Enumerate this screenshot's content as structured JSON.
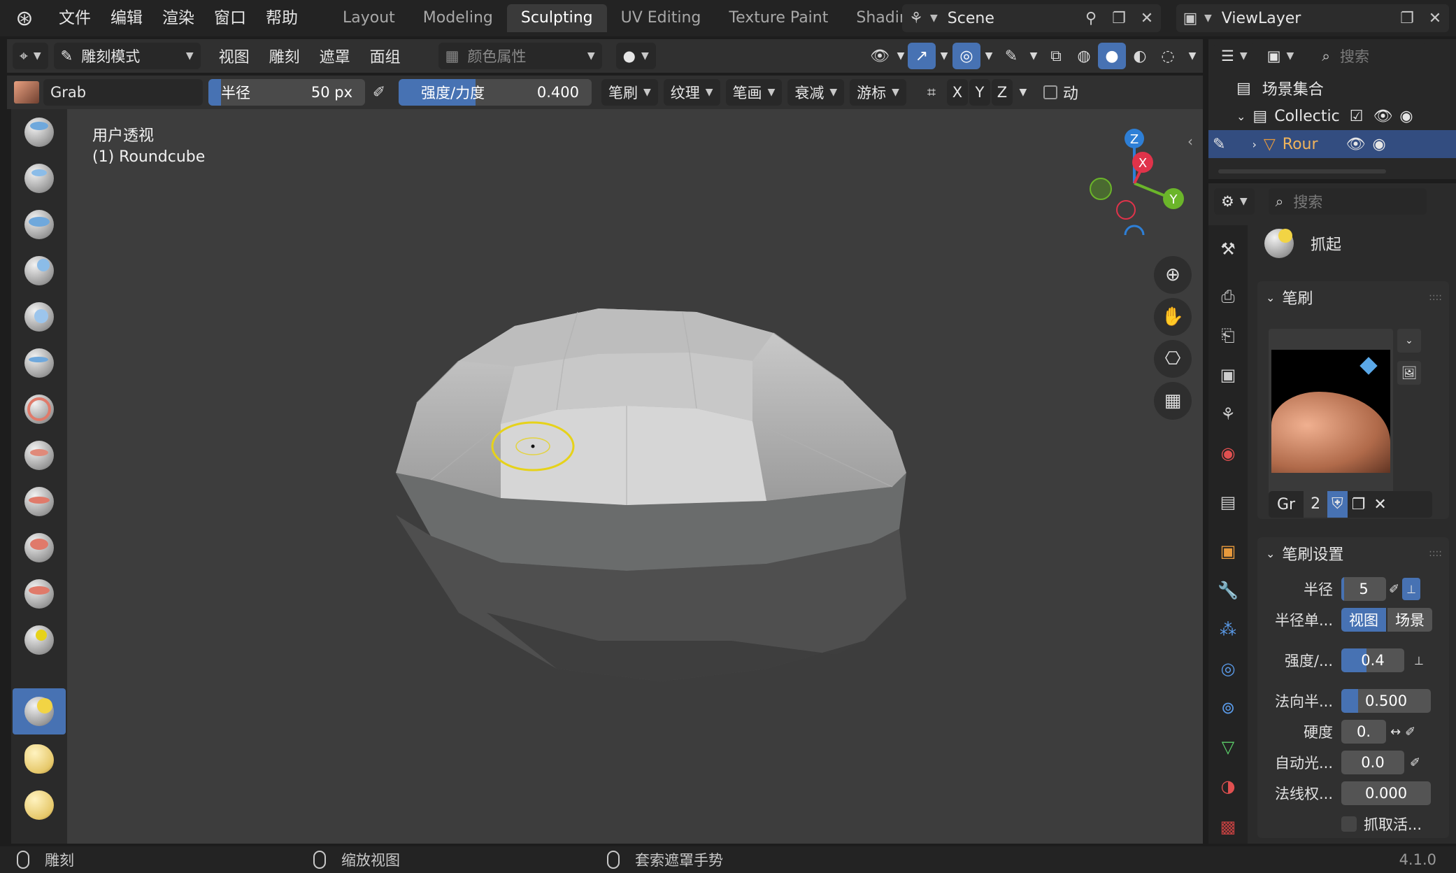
{
  "menu": {
    "items": [
      "文件",
      "编辑",
      "渲染",
      "窗口",
      "帮助"
    ]
  },
  "workspaces": {
    "tabs": [
      "Layout",
      "Modeling",
      "Sculpting",
      "UV Editing",
      "Texture Paint",
      "Shading"
    ],
    "active": "Sculpting"
  },
  "scene": {
    "name": "Scene"
  },
  "view_layer": {
    "name": "ViewLayer"
  },
  "header": {
    "mode": "雕刻模式",
    "menus": [
      "视图",
      "雕刻",
      "遮罩",
      "面组"
    ],
    "color_attr": "颜色属性"
  },
  "tool_header": {
    "brush_name": "Grab",
    "radius_label": "半径",
    "radius_value": "50 px",
    "strength_label": "强度/力度",
    "strength_value": "0.400",
    "strength_fraction": 0.4,
    "dropdowns": [
      "笔刷",
      "纹理",
      "笔画",
      "衰减",
      "游标"
    ],
    "axes": [
      "X",
      "Y",
      "Z"
    ],
    "dyn_label": "动"
  },
  "viewport": {
    "view_name": "用户透视",
    "object_label": "(1) Roundcube"
  },
  "gizmo": {
    "x": "X",
    "y": "Y",
    "z": "Z"
  },
  "outliner": {
    "search_placeholder": "搜索",
    "scene_collection": "场景集合",
    "collection": "Collectic",
    "object": "Rour"
  },
  "properties": {
    "search_placeholder": "搜索",
    "tool_name": "抓起",
    "brush_panel_title": "笔刷",
    "brush_name_short": "Gr",
    "brush_users": "2",
    "settings_panel_title": "笔刷设置",
    "radius_label": "半径",
    "radius_value": "5",
    "radius_unit_label": "半径单...",
    "radius_unit_view": "视图",
    "radius_unit_scene": "场景",
    "strength_label": "强度/...",
    "strength_value": "0.4",
    "normal_radius_label": "法向半...",
    "normal_radius_value": "0.500",
    "hardness_label": "硬度",
    "hardness_value": "0.",
    "autosmooth_label": "自动光...",
    "autosmooth_value": "0.0",
    "normal_weight_label": "法线权...",
    "normal_weight_value": "0.000",
    "grab_active_label": "抓取活..."
  },
  "statusbar": {
    "left": "雕刻",
    "middle": "缩放视图",
    "right": "套索遮罩手势",
    "version": "4.1.0"
  },
  "colors": {
    "accent": "#4772b3",
    "cursor": "#e6d21a",
    "axis_x": "#e0334a",
    "axis_y": "#6bb52a",
    "axis_z": "#2e7fd6"
  }
}
